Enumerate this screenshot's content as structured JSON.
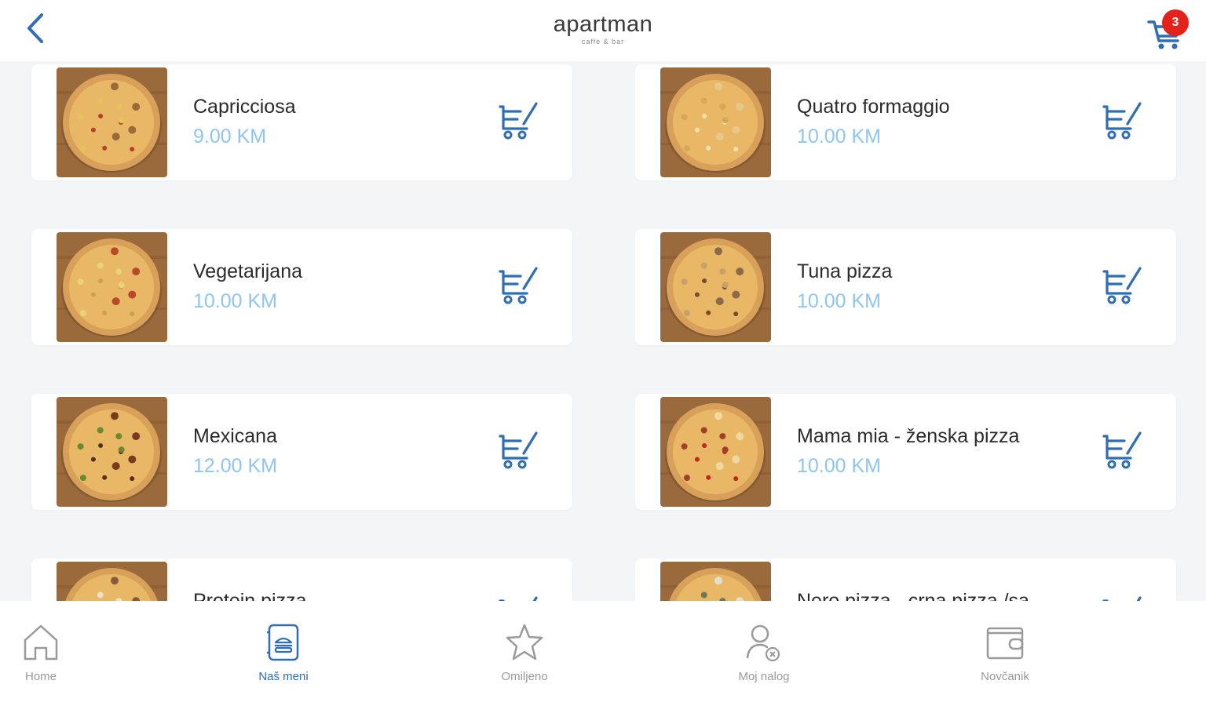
{
  "header": {
    "logo_main": "apartman",
    "logo_sub": "caffe & bar",
    "cart_count": "3"
  },
  "colors": {
    "accent": "#2f6db5",
    "price": "#8ec5f2",
    "badge": "#e3231b"
  },
  "products": [
    {
      "name": "Capricciosa",
      "price": "9.00 KM"
    },
    {
      "name": "Quatro formaggio",
      "price": "10.00 KM"
    },
    {
      "name": "Vegetarijana",
      "price": "10.00 KM"
    },
    {
      "name": "Tuna pizza",
      "price": "10.00 KM"
    },
    {
      "name": "Mexicana",
      "price": "12.00 KM"
    },
    {
      "name": "Mama mia - ženska pizza",
      "price": "10.00 KM"
    },
    {
      "name": "Protein pizza",
      "price": ""
    },
    {
      "name": "Nero pizza - crna pizza /sa",
      "price": ""
    }
  ],
  "nav": {
    "items": [
      {
        "label": "Home",
        "icon": "home-icon"
      },
      {
        "label": "Naš meni",
        "icon": "menu-icon"
      },
      {
        "label": "Omiljeno",
        "icon": "star-icon"
      },
      {
        "label": "Moj nalog",
        "icon": "user-icon"
      },
      {
        "label": "Novčanik",
        "icon": "wallet-icon"
      }
    ],
    "active_index": 1
  }
}
